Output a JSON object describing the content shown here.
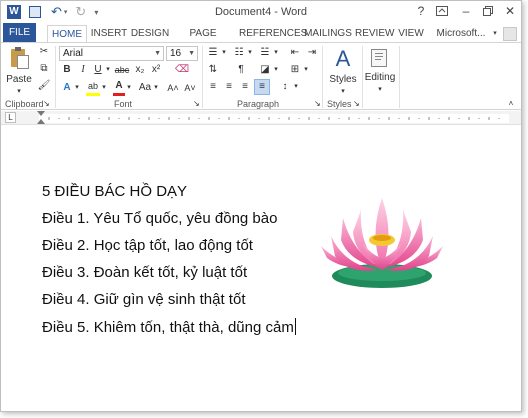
{
  "window": {
    "title": "Document4 - Word",
    "help": "?",
    "minimize": "–",
    "close": "✕"
  },
  "tabs": {
    "file": "FILE",
    "home": "HOME",
    "insert": "INSERT",
    "design": "DESIGN",
    "page_layout": "PAGE LAYOUT",
    "references": "REFERENCES",
    "mailings": "MAILINGS",
    "review": "REVIEW",
    "view": "VIEW",
    "account": "Microsoft..."
  },
  "ribbon": {
    "clipboard": {
      "label": "Clipboard",
      "paste": "Paste"
    },
    "font": {
      "label": "Font",
      "font_name": "Arial",
      "font_size": "16",
      "bold": "B",
      "italic": "I",
      "underline": "U",
      "strike": "abc",
      "subscript": "x₂",
      "superscript": "x²",
      "text_effects": "A",
      "highlight": "ab",
      "font_color": "A",
      "change_case": "Aa",
      "grow": "A˄",
      "shrink": "A˅"
    },
    "paragraph": {
      "label": "Paragraph",
      "show_marks": "¶"
    },
    "styles": {
      "label": "Styles",
      "button": "Styles"
    },
    "editing": {
      "button": "Editing"
    }
  },
  "ruler": {
    "tab_marker": "L"
  },
  "document": {
    "lines": [
      "5 ĐIỀU BÁC HỒ DẠY",
      "Điều 1. Yêu Tổ quốc, yêu đồng bào",
      "Điều 2. Học tập tốt, lao động tốt",
      "Điều 3. Đoàn kết tốt, kỷ luật tốt",
      "Điều 4. Giữ gìn vệ sinh thật tốt",
      "Điều 5. Khiêm tốn, thật thà, dũng cảm"
    ]
  },
  "colors": {
    "word_blue": "#2b579a",
    "lotus_pink": "#f06aa8",
    "leaf_green": "#1f8a5b"
  }
}
